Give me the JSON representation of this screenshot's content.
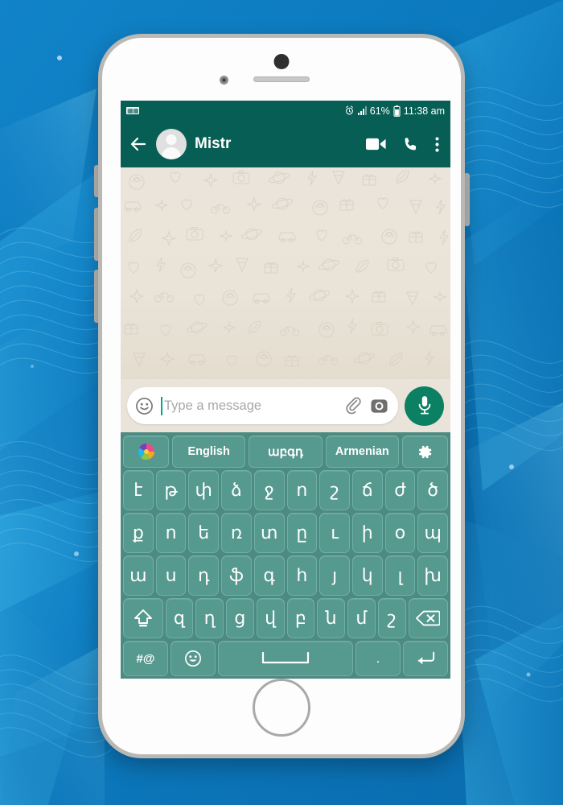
{
  "background": {
    "accent_blue": "#0f7dc2",
    "light_blue": "#2aa5e0"
  },
  "phone": {
    "frame_color": "#b9b8b5",
    "body_color": "#fdfdfd"
  },
  "status_bar": {
    "keyboard_indicator_icon": "keyboard-icon",
    "alarm_icon": "alarm-icon",
    "signal_icon": "signal-bars-icon",
    "battery_percent": "61%",
    "battery_icon": "battery-icon",
    "time": "11:38 am",
    "bg_color": "#075e54"
  },
  "chat_header": {
    "back_icon": "back-arrow-icon",
    "avatar_icon": "avatar-placeholder",
    "contact_name": "Mistr",
    "video_call_icon": "video-camera-icon",
    "voice_call_icon": "phone-icon",
    "overflow_icon": "more-vertical-icon",
    "bg_color": "#075e54"
  },
  "chat_body": {
    "wallpaper": "whatsapp-doodle-pattern",
    "bg_color": "#e9e3d9"
  },
  "input_bar": {
    "emoji_icon": "smiley-icon",
    "placeholder": "Type a message",
    "value": "",
    "attach_icon": "paperclip-icon",
    "camera_icon": "camera-icon",
    "mic_icon": "microphone-icon",
    "mic_button_color": "#0b8062"
  },
  "keyboard": {
    "bg_color": "#4d8a81",
    "key_color": "#56998f",
    "key_border_color": "#6fb0a6",
    "suggestion_row": [
      {
        "type": "icon",
        "name": "theme-palette-icon",
        "label": ""
      },
      {
        "type": "text",
        "name": "language-english",
        "label": "English"
      },
      {
        "type": "text",
        "name": "language-armenian-native",
        "label": "աբգդ"
      },
      {
        "type": "text",
        "name": "language-armenian",
        "label": "Armenian"
      },
      {
        "type": "icon",
        "name": "settings-gear-icon",
        "label": ""
      }
    ],
    "rows": [
      [
        "է",
        "թ",
        "փ",
        "ձ",
        "ջ",
        "ո",
        "շ",
        "ճ",
        "ժ",
        "ծ"
      ],
      [
        "ք",
        "ո",
        "ե",
        "ռ",
        "տ",
        "ը",
        "ւ",
        "ի",
        "օ",
        "պ"
      ],
      [
        "ա",
        "ս",
        "դ",
        "ֆ",
        "գ",
        "հ",
        "յ",
        "կ",
        "լ",
        "խ"
      ]
    ],
    "row4": {
      "shift_icon": "shift-up-icon",
      "letters": [
        "զ",
        "ղ",
        "ց",
        "վ",
        "բ",
        "ն",
        "մ",
        "շ"
      ],
      "backspace_icon": "backspace-icon"
    },
    "row5": {
      "symbols_label": "#@",
      "emoji_icon": "emoji-smiley-icon",
      "space_icon": "space-bar-icon",
      "period_label": ".",
      "enter_icon": "enter-return-icon"
    }
  }
}
